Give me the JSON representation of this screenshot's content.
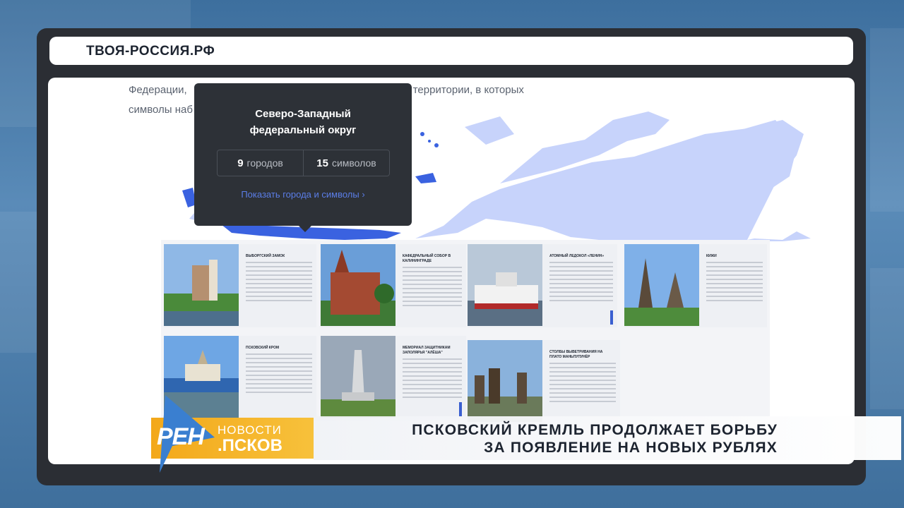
{
  "browser": {
    "url": "ТВОЯ-РОССИЯ.РФ"
  },
  "intro": {
    "line1_left": "Федерации,",
    "line1_right": "территории, в которых",
    "line2_left": "символы наб"
  },
  "tooltip": {
    "title_line1": "Северо-Западный",
    "title_line2": "федеральный округ",
    "cities_count": "9",
    "cities_label": "городов",
    "symbols_count": "15",
    "symbols_label": "символов",
    "link_label": "Показать города и символы",
    "link_chevron": "›"
  },
  "cards": [
    {
      "name": "Выборгский замок"
    },
    {
      "name": "Кафедральный собор в Калининграде"
    },
    {
      "name": "Атомный ледокол «Ленин»"
    },
    {
      "name": "Кижи"
    },
    {
      "name": "Псковский кром"
    },
    {
      "name": "Мемориал защитникам Заполярья \"Алёша\""
    },
    {
      "name": "Столбы выветривания на плато Маньпупунёр"
    }
  ],
  "broadcast": {
    "channel_logo": "РЕН",
    "program_line1": "НОВОСТИ",
    "program_line2": ".ПСКОВ",
    "headline_line1": "ПСКОВСКИЙ КРЕМЛЬ ПРОДОЛЖАЕТ БОРЬБУ",
    "headline_line2": "ЗА ПОЯВЛЕНИЕ НА НОВЫХ РУБЛЯХ"
  },
  "colors": {
    "map_fill": "#c7d3fb",
    "map_highlight": "#3a62e0",
    "tooltip_bg": "#2d3137",
    "link": "#5b7ee8",
    "ren_orange": "#f3a81a"
  }
}
